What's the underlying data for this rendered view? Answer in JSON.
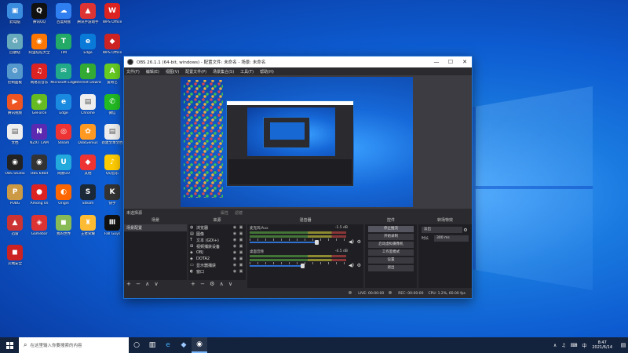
{
  "desktop": {
    "icons": [
      {
        "label": "此电脑",
        "glyph": "▣",
        "color": "#3b8de0"
      },
      {
        "label": "腾讯QQ",
        "glyph": "Q",
        "color": "#111"
      },
      {
        "label": "百度网盘",
        "glyph": "☁",
        "color": "#2f7ff0"
      },
      {
        "label": "腾讯手游助手",
        "glyph": "▲",
        "color": "#d33"
      },
      {
        "label": "WPS Office",
        "glyph": "W",
        "color": "#d22"
      },
      {
        "label": "回收站",
        "glyph": "♻",
        "color": "#6ab"
      },
      {
        "label": "阿里旺旺大全",
        "glyph": "◉",
        "color": "#f70"
      },
      {
        "label": "TIM",
        "glyph": "T",
        "color": "#2a6"
      },
      {
        "label": "Edge",
        "glyph": "e",
        "color": "#0a7ad8"
      },
      {
        "label": "WPS Office",
        "glyph": "◆",
        "color": "#c22"
      },
      {
        "label": "控制面板",
        "glyph": "⚙",
        "color": "#59c"
      },
      {
        "label": "网易云音乐",
        "glyph": "♫",
        "color": "#d22"
      },
      {
        "label": "Microsoft Edge",
        "glyph": "✉",
        "color": "#2a8"
      },
      {
        "label": "Internet Download",
        "glyph": "⬇",
        "color": "#3a3"
      },
      {
        "label": "爱奇艺",
        "glyph": "A",
        "color": "#6c2"
      },
      {
        "label": "腾讯视频",
        "glyph": "▶",
        "color": "#e52"
      },
      {
        "label": "GeForce",
        "glyph": "◈",
        "color": "#6b2"
      },
      {
        "label": "Edge",
        "glyph": "e",
        "color": "#1a8ae0"
      },
      {
        "label": "Chrome",
        "glyph": "▤",
        "color": "#eee"
      },
      {
        "label": "微信",
        "glyph": "✆",
        "color": "#2b2"
      },
      {
        "label": "文档",
        "glyph": "▤",
        "color": "#eee"
      },
      {
        "label": "NZXT CAM",
        "glyph": "N",
        "color": "#5b2ab0"
      },
      {
        "label": "Steam",
        "glyph": "◎",
        "color": "#e33"
      },
      {
        "label": "DiskGenius",
        "glyph": "✿",
        "color": "#f92"
      },
      {
        "label": "新建文本文档",
        "glyph": "▤",
        "color": "#eee"
      },
      {
        "label": "OBS Studio",
        "glyph": "◉",
        "color": "#222"
      },
      {
        "label": "OBS 64bit",
        "glyph": "◉",
        "color": "#333"
      },
      {
        "label": "网易UU",
        "glyph": "U",
        "color": "#2ad"
      },
      {
        "label": "其他",
        "glyph": "◆",
        "color": "#e33"
      },
      {
        "label": "QQ音乐",
        "glyph": "♪",
        "color": "#fc0"
      },
      {
        "label": "PUBG",
        "glyph": "P",
        "color": "#c94"
      },
      {
        "label": "Among Us",
        "glyph": "●",
        "color": "#d22"
      },
      {
        "label": "Origin",
        "glyph": "◐",
        "color": "#f60"
      },
      {
        "label": "Steam",
        "glyph": "S",
        "color": "#1b2838"
      },
      {
        "label": "快手",
        "glyph": "K",
        "color": "#333"
      },
      {
        "label": "迅雷",
        "glyph": "▲",
        "color": "#c33"
      },
      {
        "label": "Gamebar",
        "glyph": "◈",
        "color": "#d33"
      },
      {
        "label": "我的世界",
        "glyph": "◼",
        "color": "#8b5"
      },
      {
        "label": "王者荣耀",
        "glyph": "♜",
        "color": "#fb3"
      },
      {
        "label": "Fall Guys",
        "glyph": "Ⅲ",
        "color": "#111"
      },
      {
        "label": "火绒安全",
        "glyph": "◼",
        "color": "#c22"
      }
    ]
  },
  "obs": {
    "title": "OBS 26.1.1 (64-bit, windows) - 配置文件: 未命名 - 场景: 未命名",
    "window_controls": [
      "—",
      "☐",
      "✕"
    ],
    "menu": [
      "文件(F)",
      "编辑(E)",
      "视图(V)",
      "配置文件(P)",
      "场景集合(S)",
      "工具(T)",
      "帮助(H)"
    ],
    "status_top": {
      "label": "未选择源",
      "properties": "属性",
      "filters": "滤镜"
    },
    "scenes": {
      "header": "场景",
      "items": [
        "场景配置"
      ],
      "footer": "+ − ∧ ∨"
    },
    "sources": {
      "header": "来源",
      "items": [
        {
          "icon": "◍",
          "name": "浏览器"
        },
        {
          "icon": "▤",
          "name": "图像"
        },
        {
          "icon": "T",
          "name": "文本 (GDI+)"
        },
        {
          "icon": "⊞",
          "name": "视频捕获设备"
        },
        {
          "icon": "◈",
          "name": "OBJ"
        },
        {
          "icon": "◈",
          "name": "DOTA2"
        },
        {
          "icon": "▭",
          "name": "显示器捕获"
        },
        {
          "icon": "◐",
          "name": "窗口"
        }
      ],
      "footer": "+ − ⚙ ∧ ∨"
    },
    "mixer": {
      "header": "混音器",
      "channels": [
        {
          "name": "麦克风/Aux",
          "db": "-1.5 dB",
          "level": 0.7
        },
        {
          "name": "桌面音频",
          "db": "-4.5 dB",
          "level": 0.55
        }
      ]
    },
    "controls": {
      "header": "控件",
      "buttons": [
        "停止推流",
        "开始录制",
        "启动虚拟摄像机",
        "工作室模式",
        "设置",
        "退出"
      ]
    },
    "transitions": {
      "header": "转场特效",
      "select": "淡出",
      "duration_label": "时长",
      "duration": "300 ms"
    },
    "statusbar": {
      "live": "LIVE: 00:00:00",
      "rec": "REC: 00:00:00",
      "cpu": "CPU: 1.2%, 60.00 fps"
    }
  },
  "taskbar": {
    "search_placeholder": "在这里输入你要搜索的内容",
    "apps": [
      "○",
      "▥",
      "e",
      "◆",
      "◉"
    ],
    "tray": [
      "∧",
      "♫",
      "⌨",
      "中"
    ],
    "time": "8:47",
    "date": "2021/6/14",
    "notifications": "▤"
  }
}
